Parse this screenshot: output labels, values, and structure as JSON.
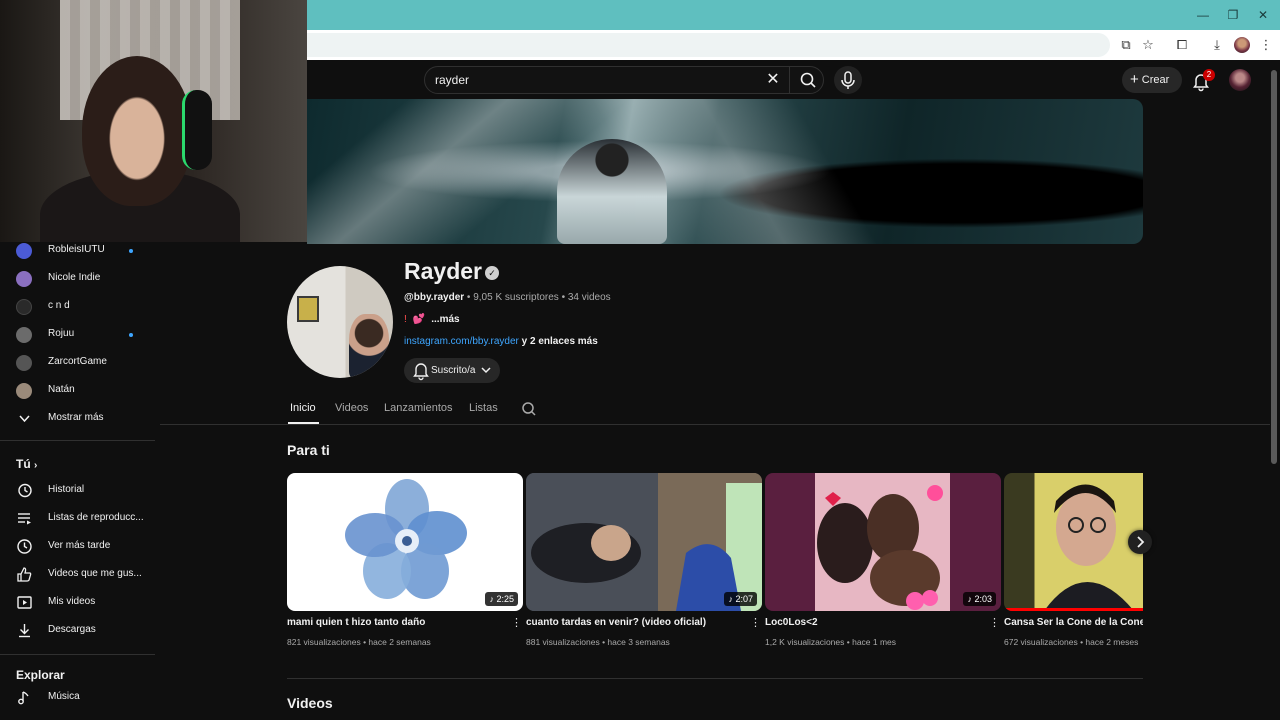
{
  "header": {
    "search_value": "rayder",
    "create_label": "Crear",
    "notification_count": "2"
  },
  "sidebar": {
    "subscriptions": [
      {
        "label": "RobleisIUTU",
        "avatar_color": "#4b5bd6",
        "dot": true
      },
      {
        "label": "Nicole Indie",
        "avatar_color": "#8a6fbf",
        "dot": false
      },
      {
        "label": "c n d",
        "avatar_color": "#2a2a2a",
        "dot": false
      },
      {
        "label": "Rojuu",
        "avatar_color": "#6b6b6b",
        "dot": true
      },
      {
        "label": "ZarcortGame",
        "avatar_color": "#555555",
        "dot": false
      },
      {
        "label": "Natán",
        "avatar_color": "#9a8a7a",
        "dot": false
      }
    ],
    "show_more_label": "Mostrar más",
    "you_heading": "Tú",
    "you_items": [
      {
        "label": "Historial",
        "icon": "history-icon"
      },
      {
        "label": "Listas de reproducc...",
        "icon": "playlist-icon"
      },
      {
        "label": "Ver más tarde",
        "icon": "clock-icon"
      },
      {
        "label": "Videos que me gus...",
        "icon": "thumbs-up-icon"
      },
      {
        "label": "Mis videos",
        "icon": "play-square-icon"
      },
      {
        "label": "Descargas",
        "icon": "download-icon"
      }
    ],
    "explore_heading": "Explorar",
    "explore_items": [
      {
        "label": "Música",
        "icon": "music-note-icon"
      }
    ]
  },
  "channel": {
    "name": "Rayder",
    "handle": "@bby.rayder",
    "meta_rest": " • 9,05 K suscriptores • 34 videos",
    "desc_excl": "!",
    "desc_heart": "💕",
    "desc_more": "...más",
    "link": "instagram.com/bby.rayder",
    "more_links": " y 2 enlaces más",
    "subscribe_label": "Suscrito/a"
  },
  "tabs": [
    {
      "label": "Inicio",
      "active": true
    },
    {
      "label": "Videos",
      "active": false
    },
    {
      "label": "Lanzamientos",
      "active": false
    },
    {
      "label": "Listas",
      "active": false
    }
  ],
  "sections": {
    "for_you": "Para ti",
    "videos": "Videos"
  },
  "videos": [
    {
      "title": "mami quien t hizo tanto daño",
      "duration": "♪ 2:25",
      "views": "821 visualizaciones",
      "age": "hace 2 semanas",
      "watched_fraction": 0
    },
    {
      "title": "cuanto tardas en venir? (video oficial)",
      "duration": "♪ 2:07",
      "views": "881 visualizaciones",
      "age": "hace 3 semanas",
      "watched_fraction": 0
    },
    {
      "title": "Loc0Los<2",
      "duration": "♪ 2:03",
      "views": "1,2 K visualizaciones",
      "age": "hace 1 mes",
      "watched_fraction": 0
    },
    {
      "title": "Cansa Ser la Cone de la Cone",
      "duration": "",
      "views": "672 visualizaciones",
      "age": "hace 2 meses",
      "watched_fraction": 1.0
    }
  ],
  "colors": {
    "accent_link": "#3ea6ff",
    "notification_red": "#cc0000",
    "browser_frame": "#5fbfbf"
  }
}
